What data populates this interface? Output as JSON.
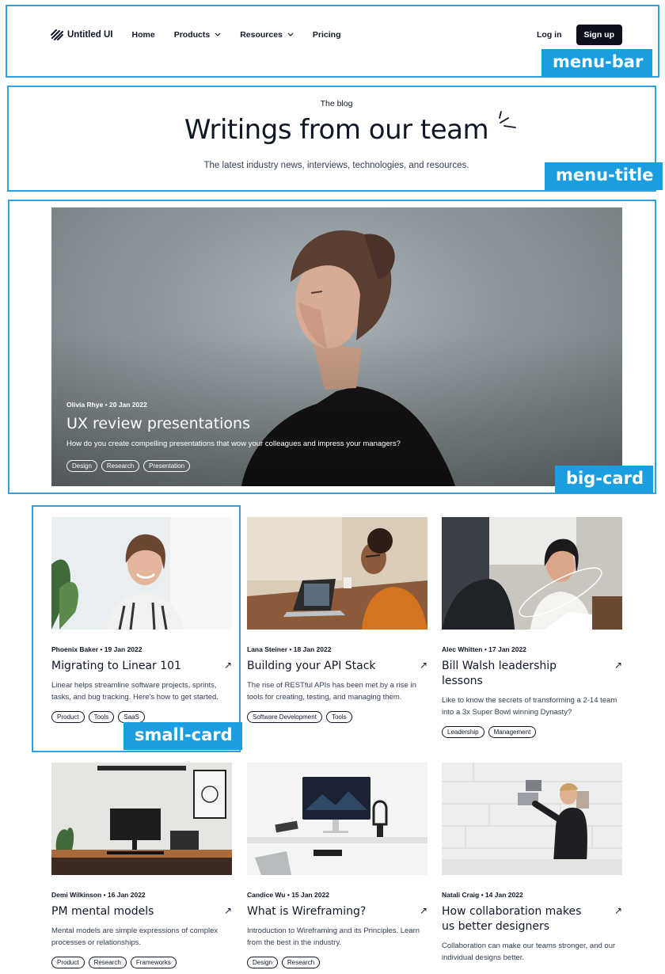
{
  "nav": {
    "logo_text": "Untitled UI",
    "links": [
      {
        "label": "Home"
      },
      {
        "label": "Products"
      },
      {
        "label": "Resources"
      },
      {
        "label": "Pricing"
      }
    ],
    "login_label": "Log in",
    "signup_label": "Sign up"
  },
  "hero": {
    "eyebrow": "The blog",
    "title": "Writings from our team",
    "subtitle": "The latest industry news, interviews, technologies, and resources."
  },
  "featured": {
    "meta": "Olivia Rhye • 20 Jan 2022",
    "title": "UX review presentations",
    "description": "How do you create compelling presentations that wow your colleagues and impress your managers?",
    "tags": [
      "Design",
      "Research",
      "Presentation"
    ]
  },
  "posts": [
    {
      "meta": "Phoenix Baker • 19 Jan 2022",
      "title": "Migrating to Linear 101",
      "description": "Linear helps streamline software projects, sprints, tasks, and bug tracking. Here's how to get started.",
      "tags": [
        "Product",
        "Tools",
        "SaaS"
      ],
      "arrow": "↗"
    },
    {
      "meta": "Lana Steiner • 18 Jan 2022",
      "title": "Building your API Stack",
      "description": "The rise of RESTful APIs has been met by a rise in tools for creating, testing, and managing them.",
      "tags": [
        "Software Development",
        "Tools"
      ],
      "arrow": "↗"
    },
    {
      "meta": "Alec Whitten • 17 Jan 2022",
      "title": "Bill Walsh leadership lessons",
      "description": "Like to know the secrets of transforming a 2-14 team into a 3x Super Bowl winning Dynasty?",
      "tags": [
        "Leadership",
        "Management"
      ],
      "arrow": "↗"
    },
    {
      "meta": "Demi Wilkinson • 16 Jan 2022",
      "title": "PM mental models",
      "description": "Mental models are simple expressions of complex processes or relationships.",
      "tags": [
        "Product",
        "Research",
        "Frameworks"
      ],
      "arrow": "↗"
    },
    {
      "meta": "Candice Wu • 15 Jan 2022",
      "title": "What is Wireframing?",
      "description": "Introduction to Wireframing and its Principles. Learn from the best in the industry.",
      "tags": [
        "Design",
        "Research"
      ],
      "arrow": "↗"
    },
    {
      "meta": "Natali Craig • 14 Jan 2022",
      "title": "How collaboration makes us better designers",
      "description": "Collaboration can make our teams stronger, and our individual designs better.",
      "tags": [],
      "arrow": "↗"
    }
  ],
  "annotations": {
    "menu_bar": "menu-bar",
    "menu_title": "menu-title",
    "big_card": "big-card",
    "small_card": "small-card"
  },
  "colors": {
    "accent": "#1b9ee0",
    "dark": "#0c111d",
    "text": "#101828"
  }
}
